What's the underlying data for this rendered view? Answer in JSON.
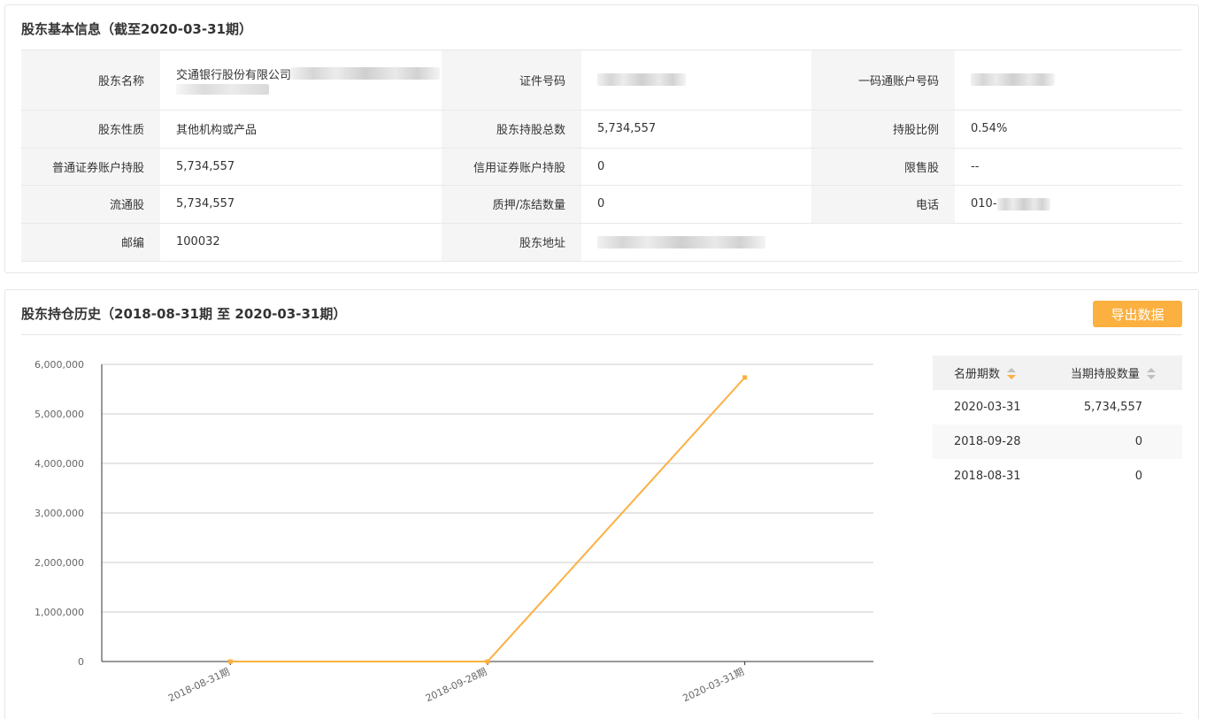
{
  "info": {
    "title": "股东基本信息（截至2020-03-31期）",
    "rows": [
      [
        {
          "label": "股东名称",
          "value": "交通银行股份有限公司",
          "masked": true,
          "wrap": true
        },
        {
          "label": "证件号码",
          "value": "",
          "masked": true
        },
        {
          "label": "一码通账户号码",
          "value": "",
          "masked": true
        }
      ],
      [
        {
          "label": "股东性质",
          "value": "其他机构或产品"
        },
        {
          "label": "股东持股总数",
          "value": "5,734,557"
        },
        {
          "label": "持股比例",
          "value": "0.54%"
        }
      ],
      [
        {
          "label": "普通证券账户持股",
          "value": "5,734,557"
        },
        {
          "label": "信用证券账户持股",
          "value": "0"
        },
        {
          "label": "限售股",
          "value": "--"
        }
      ],
      [
        {
          "label": "流通股",
          "value": "5,734,557"
        },
        {
          "label": "质押/冻结数量",
          "value": "0"
        },
        {
          "label": "电话",
          "value": "010-",
          "masked": true
        }
      ],
      [
        {
          "label": "邮编",
          "value": "100032"
        },
        {
          "label": "股东地址",
          "value": "",
          "masked": true
        }
      ]
    ]
  },
  "history": {
    "title": "股东持仓历史（2018-08-31期 至 2020-03-31期）",
    "export_label": "导出数据",
    "table": {
      "headers": [
        "名册期数",
        "当期持股数量"
      ],
      "rows": [
        [
          "2020-03-31",
          "5,734,557"
        ],
        [
          "2018-09-28",
          "0"
        ],
        [
          "2018-08-31",
          "0"
        ]
      ]
    }
  },
  "colors": {
    "accent": "#fbb040",
    "label_bg": "#f5f5f5",
    "border": "#e6e6e6"
  },
  "chart_data": {
    "type": "line",
    "categories": [
      "2018-08-31期",
      "2018-09-28期",
      "2020-03-31期"
    ],
    "series": [
      {
        "values": [
          0,
          0,
          5734557
        ],
        "color": "#fbb040"
      }
    ],
    "ylim": [
      0,
      6000000
    ],
    "yticks": [
      "0",
      "1,000,000",
      "2,000,000",
      "3,000,000",
      "4,000,000",
      "5,000,000",
      "6,000,000"
    ],
    "ytick_values": [
      0,
      1000000,
      2000000,
      3000000,
      4000000,
      5000000,
      6000000
    ],
    "grid": true,
    "legend": "none"
  }
}
